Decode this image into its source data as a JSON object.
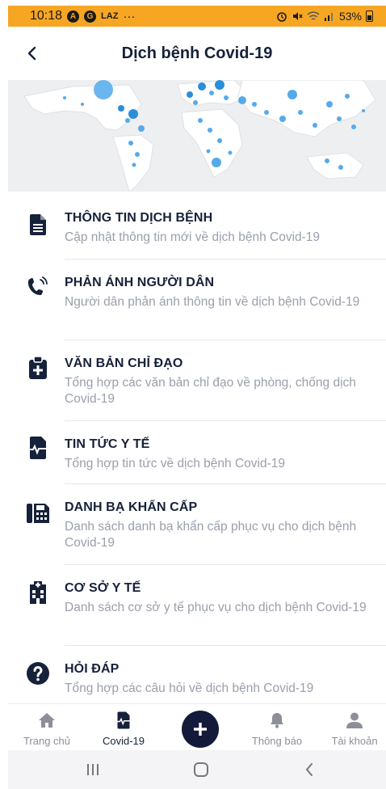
{
  "status_bar": {
    "time": "10:18",
    "icon_a": "A",
    "icon_b": "G",
    "icon_c": "LAZ",
    "more": "···",
    "battery": "53%"
  },
  "header": {
    "title": "Dịch bệnh Covid-19"
  },
  "menu": {
    "items": [
      {
        "title": "THÔNG TIN DỊCH BỆNH",
        "desc": "Cập nhật thông tin mới về dịch bệnh Covid-19",
        "icon": "document-icon"
      },
      {
        "title": "PHẢN ÁNH NGƯỜI DÂN",
        "desc": "Người dân phản ánh thông tin về dịch bệnh Covid-19",
        "icon": "phone-call-icon"
      },
      {
        "title": "VĂN BẢN CHỈ ĐẠO",
        "desc": "Tổng hợp các văn bản chỉ đạo về phòng, chống dịch Covid-19",
        "icon": "clipboard-plus-icon"
      },
      {
        "title": "TIN TỨC Y TẾ",
        "desc": "Tổng hợp tin tức về dịch bệnh Covid-19",
        "icon": "medical-file-icon"
      },
      {
        "title": "DANH BẠ KHẨN CẤP",
        "desc": "Danh sách danh bạ khẩn cấp phục vụ cho dịch bệnh Covid-19",
        "icon": "fax-icon"
      },
      {
        "title": "CƠ SỞ Y TẾ",
        "desc": "Danh sách cơ sở y tế phục vụ cho dịch bệnh Covid-19",
        "icon": "hospital-icon"
      },
      {
        "title": "HỎI ĐÁP",
        "desc": "Tổng hợp các câu hỏi về dịch bệnh Covid-19",
        "icon": "question-icon"
      }
    ]
  },
  "bottom_nav": {
    "items": [
      {
        "label": "Trang chủ",
        "icon": "home-icon"
      },
      {
        "label": "Covid-19",
        "icon": "medical-file-icon",
        "active": true
      },
      {
        "label": "Thông báo",
        "icon": "bell-icon"
      },
      {
        "label": "Tài khoản",
        "icon": "user-icon"
      }
    ],
    "fab_icon": "plus-icon"
  },
  "colors": {
    "status_bar": "#f6a623",
    "title": "#16213a",
    "fab": "#131a3a",
    "desc": "#9a9fad"
  }
}
